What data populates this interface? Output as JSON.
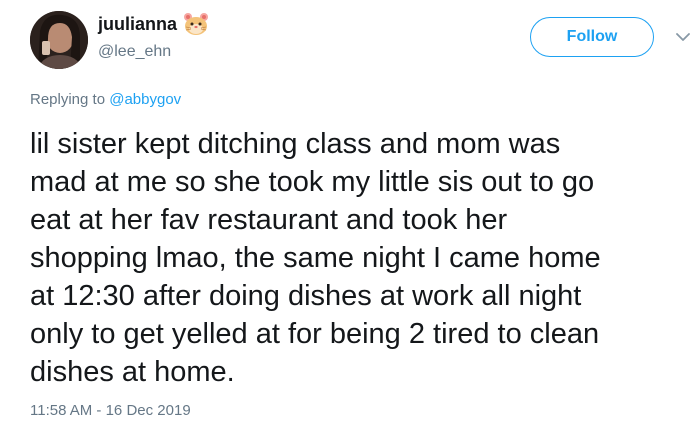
{
  "user": {
    "display_name": "juulianna",
    "handle": "@lee_ehn",
    "name_emoji": "hamster-face-emoji"
  },
  "actions": {
    "follow_label": "Follow"
  },
  "reply": {
    "prefix": "Replying to ",
    "mention": "@abbygov"
  },
  "tweet": {
    "lines": [
      "lil sister kept ditching class and mom was",
      "mad at me so she took my little sis out to go",
      "eat at her fav restaurant and took her",
      "shopping lmao, the same night I came home",
      "at 12:30 after doing dishes at work all night",
      "only to get yelled at for being 2 tired to clean",
      "dishes at home."
    ],
    "timestamp": "11:58 AM - 16 Dec 2019"
  },
  "colors": {
    "accent": "#1da1f2",
    "secondary_text": "#657786",
    "primary_text": "#14171a"
  }
}
